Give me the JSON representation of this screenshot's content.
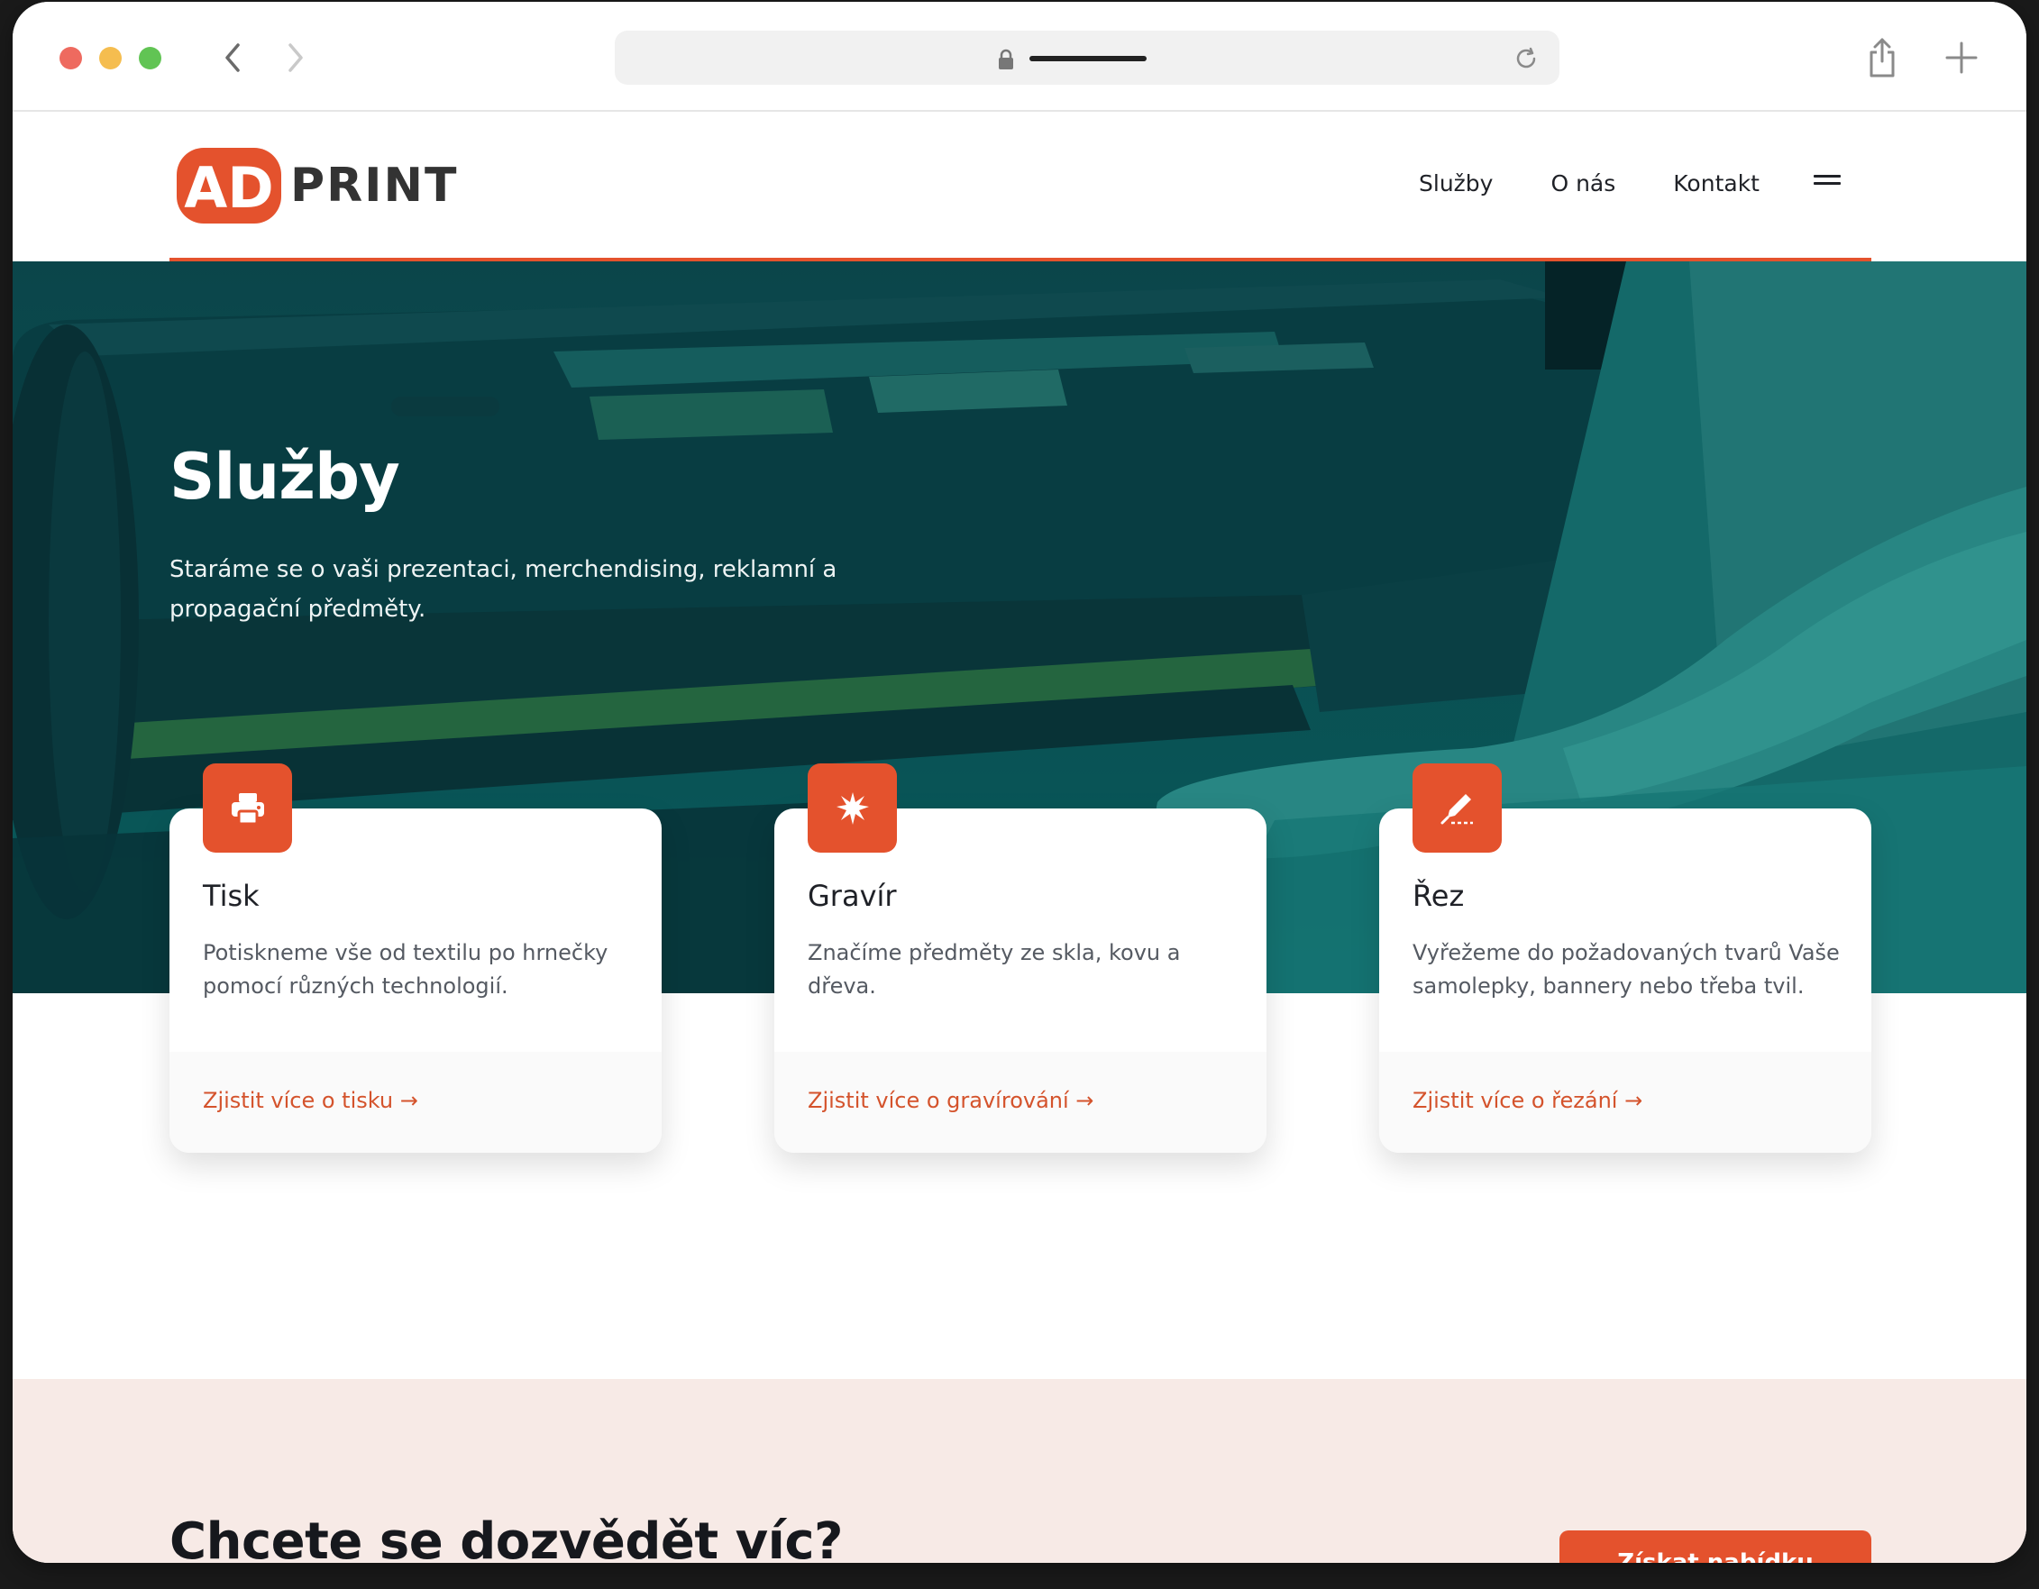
{
  "brand": {
    "logo_mark": "AD",
    "logo_text": "PRINT",
    "accent_color": "#e4522d"
  },
  "browser": {
    "icons": [
      "chevron-left-icon",
      "chevron-right-icon",
      "lock-icon",
      "reload-icon",
      "share-icon",
      "plus-icon"
    ]
  },
  "nav": {
    "items": [
      {
        "label": "Služby"
      },
      {
        "label": "O nás"
      },
      {
        "label": "Kontakt"
      }
    ],
    "menu_icon": "hamburger-icon"
  },
  "hero": {
    "title": "Služby",
    "subtitle": "Staráme se o vaši prezentaci, merchendising, reklamní a propagační předměty."
  },
  "services": [
    {
      "icon": "printer-icon",
      "title": "Tisk",
      "description": "Potiskneme vše od textilu po hrnečky pomocí různých technologií.",
      "link": "Zjistit více o tisku →"
    },
    {
      "icon": "burst-icon",
      "title": "Gravír",
      "description": "Značíme předměty ze skla, kovu a dřeva.",
      "link": "Zjistit více o gravírování →"
    },
    {
      "icon": "scalpel-icon",
      "title": "Řez",
      "description": "Vyřežeme do požadovaných tvarů Vaše samolepky, bannery nebo třeba tvil.",
      "link": "Zjistit více o řezání →"
    }
  ],
  "cta": {
    "title": "Chcete se dozvědět víc?",
    "button": "Získat nabídku"
  }
}
